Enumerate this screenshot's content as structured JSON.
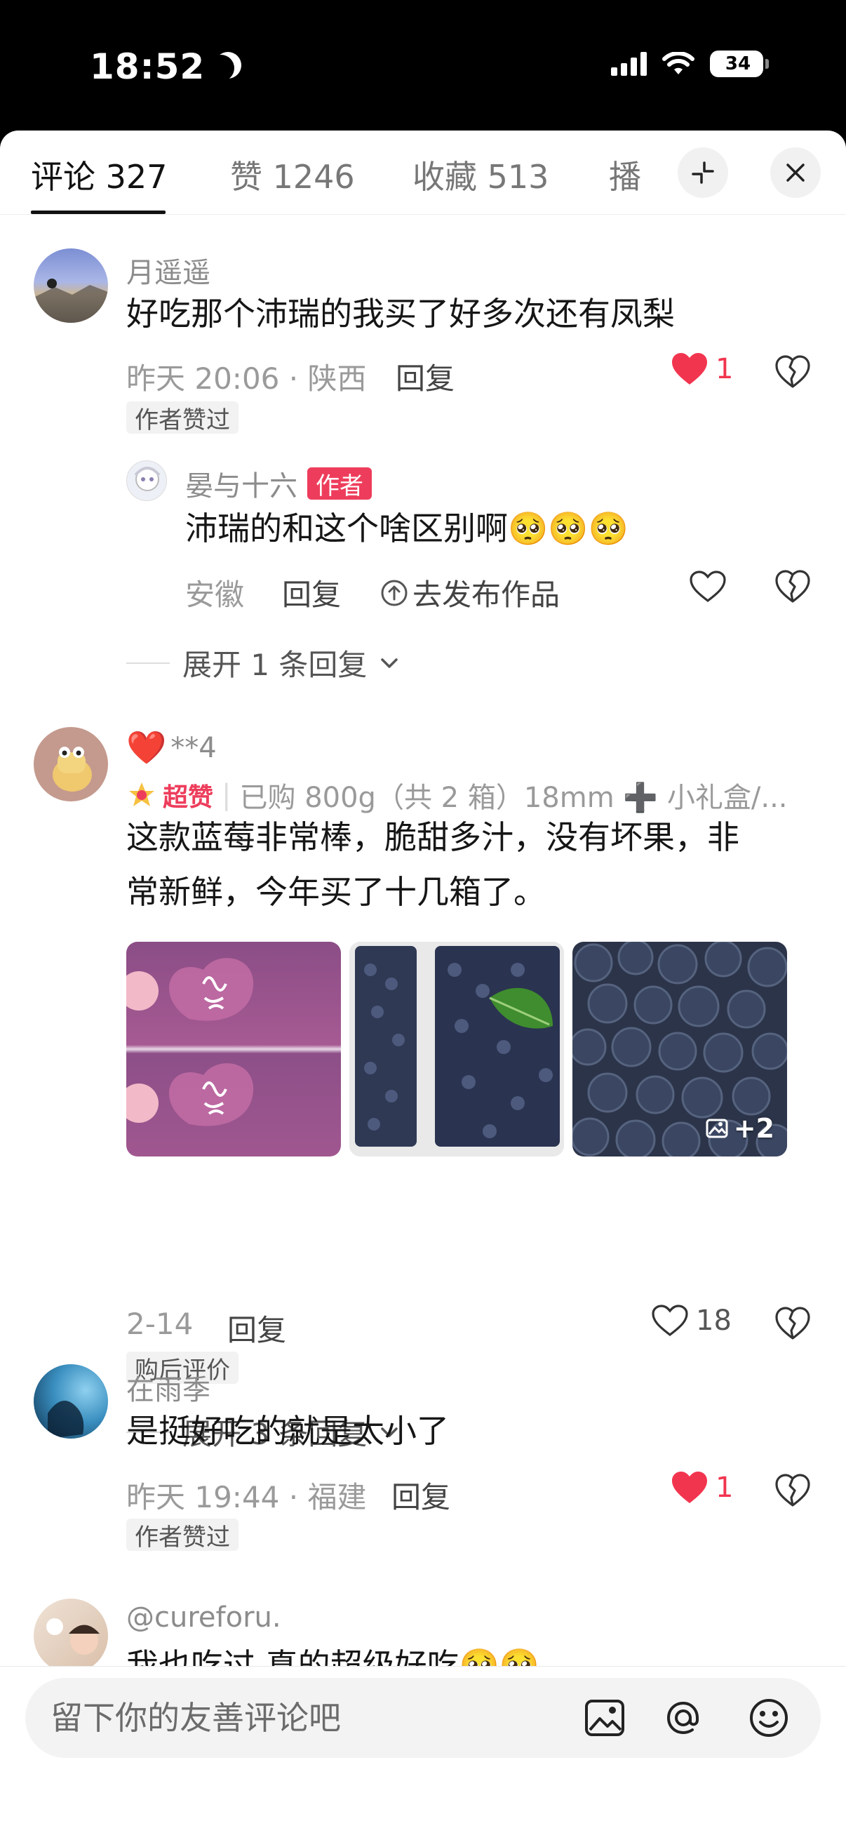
{
  "status": {
    "time": "18:52",
    "battery": "34"
  },
  "tabs": [
    {
      "label": "评论 327"
    },
    {
      "label": "赞 1246"
    },
    {
      "label": "收藏 513"
    },
    {
      "label": "播"
    }
  ],
  "comments": [
    {
      "user": "月遥遥",
      "text": "好吃那个沛瑞的我买了好多次还有凤梨",
      "meta": "昨天 20:06 · 陕西",
      "reply_label": "回复",
      "likes": "1",
      "chip": "作者赞过",
      "sub_reply": {
        "user": "晏与十六",
        "badge": "作者",
        "text": "沛瑞的和这个啥区别啊🥺🥺🥺",
        "location": "安徽",
        "reply_label": "回复",
        "publish_label": "去发布作品"
      },
      "expand": "展开 1 条回复"
    },
    {
      "user_heart": "❤️",
      "user": "**4",
      "super_like": "超赞",
      "purchase": "已购 800g（共 2 箱）18mm ➕ 小礼盒/...",
      "text_line1": "这款蓝莓非常棒，脆甜多汁，没有坏果，非",
      "text_line2": "常新鲜，今年买了十几箱了。",
      "photos_more": "+2",
      "meta": "2-14",
      "reply_label": "回复",
      "likes": "18",
      "chip": "购后评价",
      "expand": "展开 3 条回复"
    },
    {
      "user": "在雨季",
      "text": "是挺好吃的就是太小了",
      "meta": "昨天 19:44 · 福建",
      "reply_label": "回复",
      "likes": "1",
      "chip": "作者赞过"
    },
    {
      "user": "@cureforu.",
      "text": "我也吃过 真的超级好吃🥺🥺"
    }
  ],
  "input": {
    "placeholder": "留下你的友善评论吧"
  },
  "colors": {
    "accent_red": "#ee3d5c",
    "like_red": "#f2354f"
  }
}
